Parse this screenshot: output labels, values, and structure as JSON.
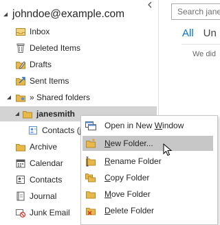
{
  "account": {
    "email": "johndoe@example.com"
  },
  "folders": {
    "inbox": "Inbox",
    "deleted": "Deleted Items",
    "drafts": "Drafts",
    "sent": "Sent Items",
    "shared": "» Shared folders",
    "janesmith": "janesmith",
    "contacts_j": "Contacts (ja",
    "archive": "Archive",
    "calendar": "Calendar",
    "contacts": "Contacts",
    "journal": "Journal",
    "junk": "Junk Email"
  },
  "search": {
    "placeholder": "Search jane"
  },
  "filters": {
    "all": "All",
    "unread": "Un"
  },
  "message_list": {
    "empty_text": "We did"
  },
  "context_menu": {
    "open_new_window": {
      "pre": "Open in New ",
      "acc": "W",
      "post": "indow"
    },
    "new_folder": {
      "pre": "",
      "acc": "N",
      "post": "ew Folder..."
    },
    "rename_folder": {
      "pre": "",
      "acc": "R",
      "post": "ename Folder"
    },
    "copy_folder": {
      "pre": "",
      "acc": "C",
      "post": "opy Folder"
    },
    "move_folder": {
      "pre": "",
      "acc": "M",
      "post": "ove Folder"
    },
    "delete_folder": {
      "pre": "",
      "acc": "D",
      "post": "elete Folder"
    }
  },
  "colors": {
    "accent": "#0072c6",
    "folder": "#e8b94a",
    "selection": "#d3d3d3",
    "menu_hover": "#c7c7c7"
  }
}
